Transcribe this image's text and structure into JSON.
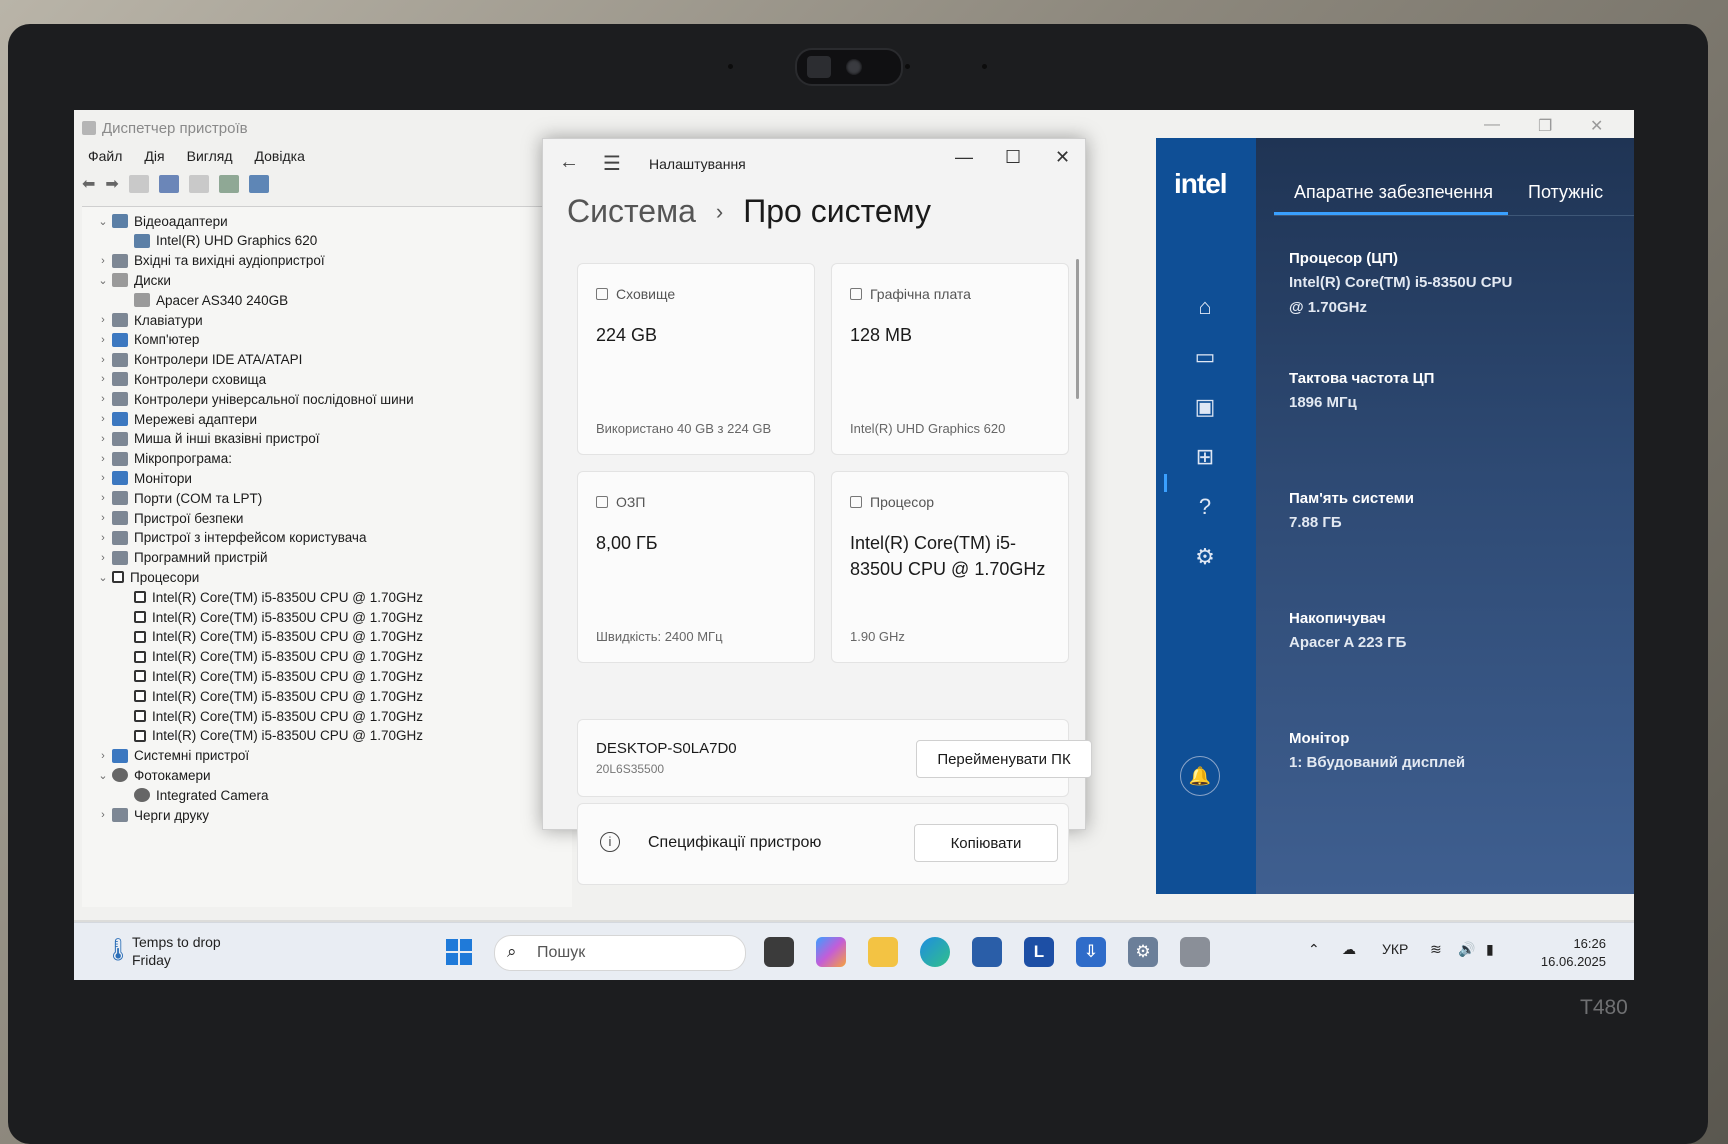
{
  "laptop": {
    "model": "T480"
  },
  "device_manager": {
    "title": "Диспетчер пристроїв",
    "menu": [
      "Файл",
      "Дія",
      "Вигляд",
      "Довідка"
    ],
    "tree": [
      {
        "label": "Відеоадаптери",
        "level": 0,
        "expanded": true,
        "icon": "gpu"
      },
      {
        "label": "Intel(R) UHD Graphics 620",
        "level": 1,
        "icon": "gpu"
      },
      {
        "label": "Вхідні та вихідні аудіопристрої",
        "level": 0,
        "expanded": false,
        "icon": "gen"
      },
      {
        "label": "Диски",
        "level": 0,
        "expanded": true,
        "icon": "disk"
      },
      {
        "label": "Apacer AS340 240GB",
        "level": 1,
        "icon": "disk"
      },
      {
        "label": "Клавіатури",
        "level": 0,
        "expanded": false,
        "icon": "gen"
      },
      {
        "label": "Комп'ютер",
        "level": 0,
        "expanded": false,
        "icon": "blue"
      },
      {
        "label": "Контролери IDE ATA/ATAPI",
        "level": 0,
        "expanded": false,
        "icon": "gen"
      },
      {
        "label": "Контролери сховища",
        "level": 0,
        "expanded": false,
        "icon": "gen"
      },
      {
        "label": "Контролери універсальної послідовної шини",
        "level": 0,
        "expanded": false,
        "icon": "gen"
      },
      {
        "label": "Мережеві адаптери",
        "level": 0,
        "expanded": false,
        "icon": "blue"
      },
      {
        "label": "Миша й інші вказівні пристрої",
        "level": 0,
        "expanded": false,
        "icon": "gen"
      },
      {
        "label": "Мікропрограма:",
        "level": 0,
        "expanded": false,
        "icon": "gen"
      },
      {
        "label": "Монітори",
        "level": 0,
        "expanded": false,
        "icon": "blue"
      },
      {
        "label": "Порти (COM та LPT)",
        "level": 0,
        "expanded": false,
        "icon": "gen"
      },
      {
        "label": "Пристрої безпеки",
        "level": 0,
        "expanded": false,
        "icon": "gen"
      },
      {
        "label": "Пристрої з інтерфейсом користувача",
        "level": 0,
        "expanded": false,
        "icon": "gen"
      },
      {
        "label": "Програмний пристрій",
        "level": 0,
        "expanded": false,
        "icon": "gen"
      },
      {
        "label": "Процесори",
        "level": 0,
        "expanded": true,
        "icon": "cpu"
      },
      {
        "label": "Intel(R) Core(TM) i5-8350U CPU @ 1.70GHz",
        "level": 1,
        "icon": "cpu"
      },
      {
        "label": "Intel(R) Core(TM) i5-8350U CPU @ 1.70GHz",
        "level": 1,
        "icon": "cpu"
      },
      {
        "label": "Intel(R) Core(TM) i5-8350U CPU @ 1.70GHz",
        "level": 1,
        "icon": "cpu"
      },
      {
        "label": "Intel(R) Core(TM) i5-8350U CPU @ 1.70GHz",
        "level": 1,
        "icon": "cpu"
      },
      {
        "label": "Intel(R) Core(TM) i5-8350U CPU @ 1.70GHz",
        "level": 1,
        "icon": "cpu"
      },
      {
        "label": "Intel(R) Core(TM) i5-8350U CPU @ 1.70GHz",
        "level": 1,
        "icon": "cpu"
      },
      {
        "label": "Intel(R) Core(TM) i5-8350U CPU @ 1.70GHz",
        "level": 1,
        "icon": "cpu"
      },
      {
        "label": "Intel(R) Core(TM) i5-8350U CPU @ 1.70GHz",
        "level": 1,
        "icon": "cpu"
      },
      {
        "label": "Системні пристрої",
        "level": 0,
        "expanded": false,
        "icon": "blue"
      },
      {
        "label": "Фотокамери",
        "level": 0,
        "expanded": true,
        "icon": "cam"
      },
      {
        "label": "Integrated Camera",
        "level": 1,
        "icon": "cam"
      },
      {
        "label": "Черги друку",
        "level": 0,
        "expanded": false,
        "icon": "gen"
      }
    ]
  },
  "settings": {
    "app_title": "Налаштування",
    "crumb_parent": "Система",
    "crumb_current": "Про систему",
    "cards": [
      {
        "id": "storage",
        "icon": "storage-icon",
        "title": "Сховище",
        "value": "224 GB",
        "sub": "Використано 40 GB з 224 GB"
      },
      {
        "id": "gpu",
        "icon": "graphics-card-icon",
        "title": "Графічна плата",
        "value": "128 MB",
        "sub": "Intel(R) UHD Graphics 620"
      },
      {
        "id": "ram",
        "icon": "ram-icon",
        "title": "ОЗП",
        "value": "8,00 ГБ",
        "sub": "Швидкість: 2400 МГц"
      },
      {
        "id": "cpu",
        "icon": "processor-icon",
        "title": "Процесор",
        "value": "Intel(R) Core(TM) i5-8350U CPU @ 1.70GHz",
        "sub": "1.90 GHz"
      }
    ],
    "pc_name": "DESKTOP-S0LA7D0",
    "pc_model": "20L6S35500",
    "rename_button": "Перейменувати ПК",
    "specs_label": "Специфікації пристрою",
    "copy_button": "Копіювати"
  },
  "intel": {
    "logo": "intel",
    "tabs": [
      "Апаратне забезпечення",
      "Потужніс"
    ],
    "items": [
      {
        "label": "Процесор (ЦП)",
        "value": "Intel(R) Core(TM) i5-8350U CPU @ 1.70GHz"
      },
      {
        "label": "Тактова частота ЦП",
        "value": "1896 МГц"
      },
      {
        "label": "Пам'ять системи",
        "value": "7.88 ГБ"
      },
      {
        "label": "Накопичувач",
        "value": "Apacer A 223 ГБ"
      },
      {
        "label": "Монітор",
        "value": "1: Вбудований дисплей"
      }
    ],
    "accent": "#39a0ff"
  },
  "taskbar": {
    "weather_title": "Temps to drop",
    "weather_sub": "Friday",
    "search_placeholder": "Пошук",
    "lang": "УКР",
    "time": "16:26",
    "date": "16.06.2025"
  }
}
